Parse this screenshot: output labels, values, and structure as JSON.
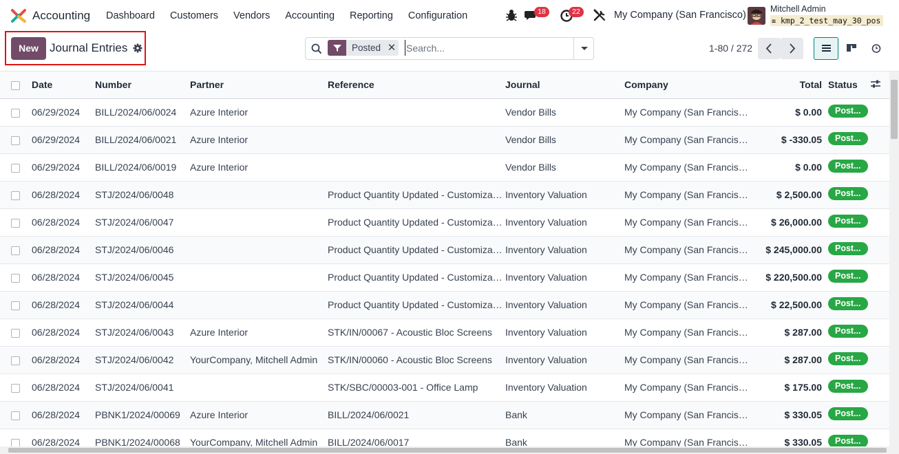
{
  "app": {
    "name": "Accounting",
    "menu": [
      "Dashboard",
      "Customers",
      "Vendors",
      "Accounting",
      "Reporting",
      "Configuration"
    ]
  },
  "systray": {
    "messages_count": "18",
    "activities_count": "22",
    "company": "My Company (San Francisco)",
    "user_name": "Mitchell Admin",
    "database": "kmp_2_test_may_30_pos"
  },
  "control": {
    "new_label": "New",
    "title": "Journal Entries",
    "facet_label": "Posted",
    "search_placeholder": "Search...",
    "pager": "1-80 / 272"
  },
  "colors": {
    "brand": "#714b67",
    "status": "#28a745",
    "highlight": "#e01313",
    "badge": "#dc3545"
  },
  "table": {
    "headers": {
      "date": "Date",
      "number": "Number",
      "partner": "Partner",
      "reference": "Reference",
      "journal": "Journal",
      "company": "Company",
      "total": "Total",
      "status": "Status"
    },
    "rows": [
      {
        "date": "06/29/2024",
        "number": "BILL/2024/06/0024",
        "partner": "Azure Interior",
        "reference": "",
        "journal": "Vendor Bills",
        "company": "My Company (San Francisco)",
        "total": "$ 0.00",
        "status": "Posted"
      },
      {
        "date": "06/29/2024",
        "number": "BILL/2024/06/0021",
        "partner": "Azure Interior",
        "reference": "",
        "journal": "Vendor Bills",
        "company": "My Company (San Francisco)",
        "total": "$ -330.05",
        "status": "Posted"
      },
      {
        "date": "06/29/2024",
        "number": "BILL/2024/06/0019",
        "partner": "Azure Interior",
        "reference": "",
        "journal": "Vendor Bills",
        "company": "My Company (San Francisco)",
        "total": "$ 0.00",
        "status": "Posted"
      },
      {
        "date": "06/28/2024",
        "number": "STJ/2024/06/0048",
        "partner": "",
        "reference": "Product Quantity Updated - Customizable Desk",
        "journal": "Inventory Valuation",
        "company": "My Company (San Francisco)",
        "total": "$ 2,500.00",
        "status": "Posted"
      },
      {
        "date": "06/28/2024",
        "number": "STJ/2024/06/0047",
        "partner": "",
        "reference": "Product Quantity Updated - Customizable Desk",
        "journal": "Inventory Valuation",
        "company": "My Company (San Francisco)",
        "total": "$ 26,000.00",
        "status": "Posted"
      },
      {
        "date": "06/28/2024",
        "number": "STJ/2024/06/0046",
        "partner": "",
        "reference": "Product Quantity Updated - Customizable Desk",
        "journal": "Inventory Valuation",
        "company": "My Company (San Francisco)",
        "total": "$ 245,000.00",
        "status": "Posted"
      },
      {
        "date": "06/28/2024",
        "number": "STJ/2024/06/0045",
        "partner": "",
        "reference": "Product Quantity Updated - Customizable Desk",
        "journal": "Inventory Valuation",
        "company": "My Company (San Francisco)",
        "total": "$ 220,500.00",
        "status": "Posted"
      },
      {
        "date": "06/28/2024",
        "number": "STJ/2024/06/0044",
        "partner": "",
        "reference": "Product Quantity Updated - Customizable Desk",
        "journal": "Inventory Valuation",
        "company": "My Company (San Francisco)",
        "total": "$ 22,500.00",
        "status": "Posted"
      },
      {
        "date": "06/28/2024",
        "number": "STJ/2024/06/0043",
        "partner": "Azure Interior",
        "reference": "STK/IN/00067 - Acoustic Bloc Screens",
        "journal": "Inventory Valuation",
        "company": "My Company (San Francisco)",
        "total": "$ 287.00",
        "status": "Posted"
      },
      {
        "date": "06/28/2024",
        "number": "STJ/2024/06/0042",
        "partner": "YourCompany, Mitchell Admin",
        "reference": "STK/IN/00060 - Acoustic Bloc Screens",
        "journal": "Inventory Valuation",
        "company": "My Company (San Francisco)",
        "total": "$ 287.00",
        "status": "Posted"
      },
      {
        "date": "06/28/2024",
        "number": "STJ/2024/06/0041",
        "partner": "",
        "reference": "STK/SBC/00003-001 - Office Lamp",
        "journal": "Inventory Valuation",
        "company": "My Company (San Francisco)",
        "total": "$ 175.00",
        "status": "Posted"
      },
      {
        "date": "06/28/2024",
        "number": "PBNK1/2024/00069",
        "partner": "Azure Interior",
        "reference": "BILL/2024/06/0021",
        "journal": "Bank",
        "company": "My Company (San Francisco)",
        "total": "$ 330.05",
        "status": "Posted"
      },
      {
        "date": "06/28/2024",
        "number": "PBNK1/2024/00068",
        "partner": "YourCompany, Mitchell Admin",
        "reference": "BILL/2024/06/0017",
        "journal": "Bank",
        "company": "My Company (San Francisco)",
        "total": "$ 330.05",
        "status": "Posted"
      }
    ]
  }
}
